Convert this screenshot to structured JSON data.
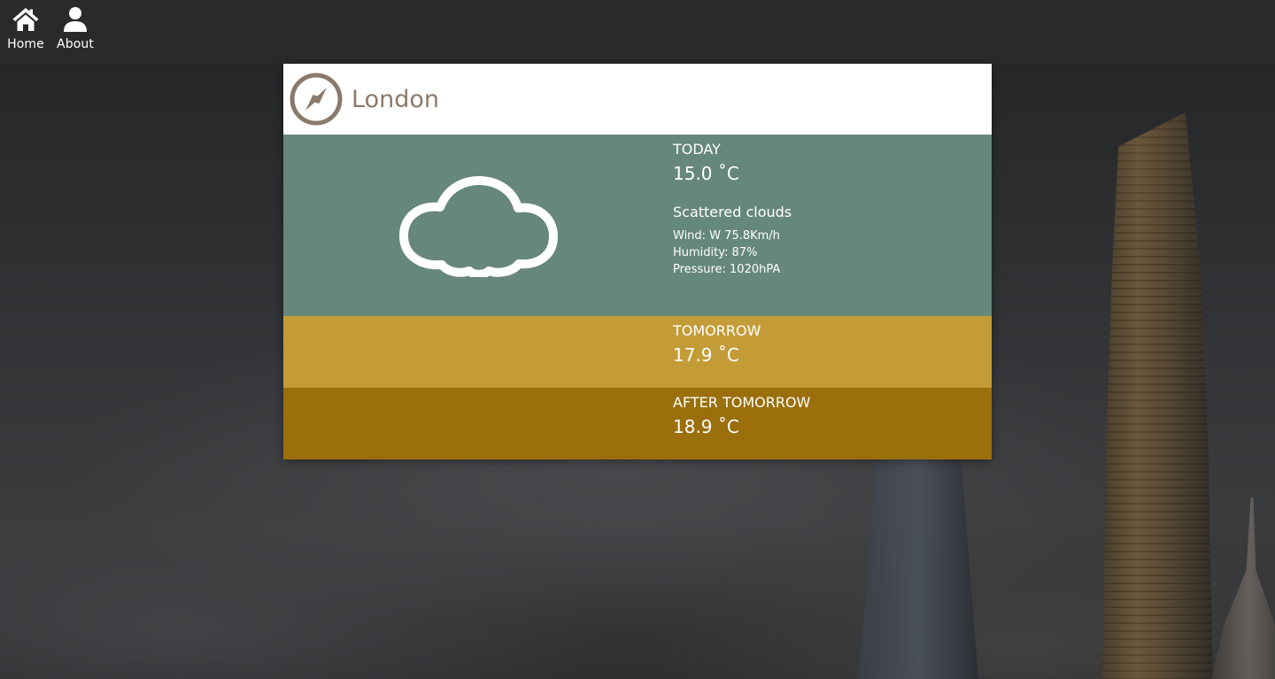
{
  "nav": {
    "home": {
      "label": "Home",
      "icon": "home-icon"
    },
    "about": {
      "label": "About",
      "icon": "user-icon"
    }
  },
  "city": {
    "name": "London",
    "icon": "compass-icon"
  },
  "today": {
    "label": "TODAY",
    "temperature": "15.0 ˚C",
    "description": "Scattered clouds",
    "icon": "cloud-icon",
    "wind": "Wind: W 75.8Km/h",
    "humidity": "Humidity: 87%",
    "pressure": "Pressure: 1020hPA"
  },
  "tomorrow": {
    "label": "TOMORROW",
    "temperature": "17.9 ˚C"
  },
  "after_tomorrow": {
    "label": "AFTER TOMORROW",
    "temperature": "18.9 ˚C"
  },
  "colors": {
    "topbar": "#2a2a2a",
    "today_bg": "#66877b",
    "tomorrow_bg": "#c49c37",
    "after_tomorrow_bg": "#9a6f0c",
    "city_text": "#8a7a6b"
  }
}
